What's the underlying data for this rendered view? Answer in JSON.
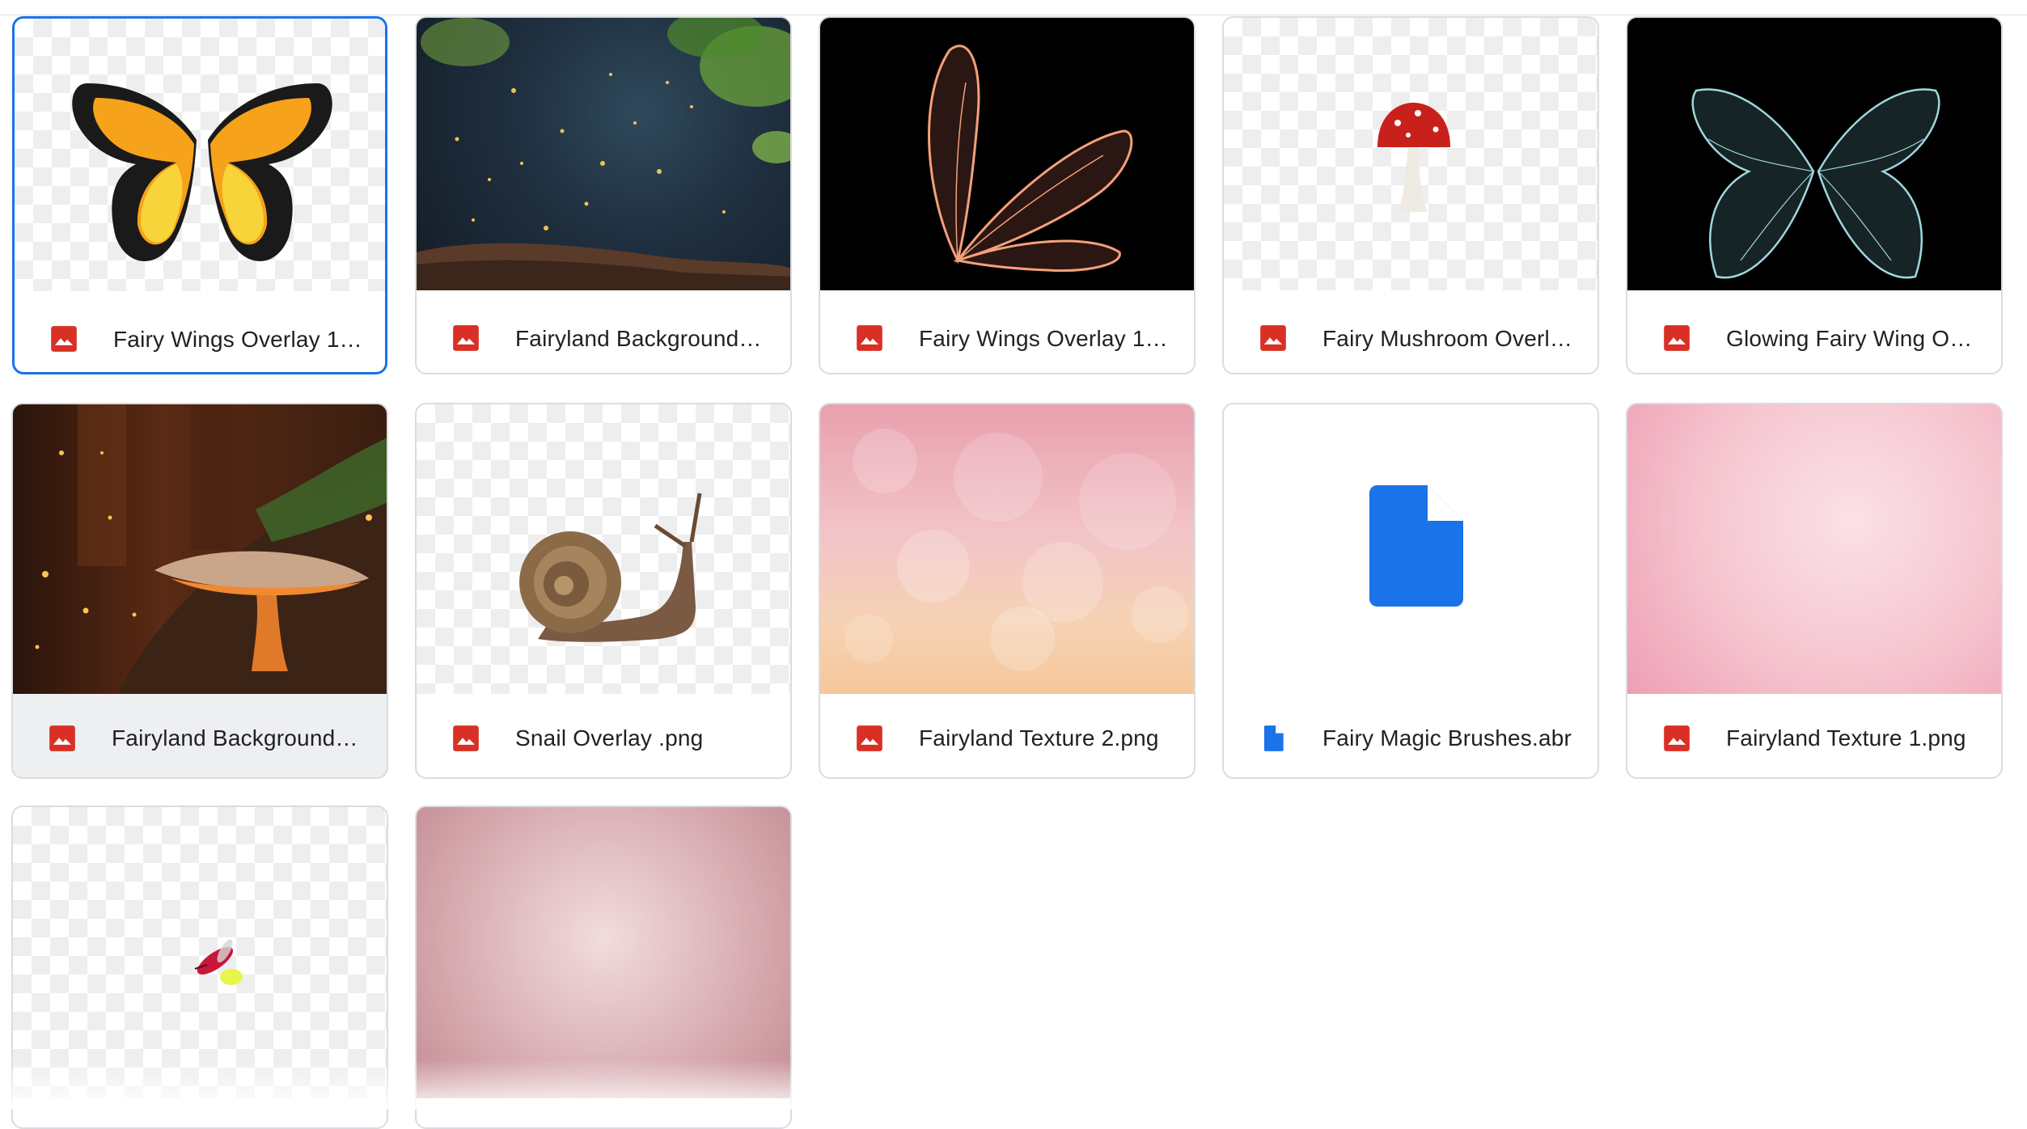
{
  "files": [
    {
      "name": "Fairy Wings Overlay 1 …",
      "type_icon": "image-file-icon",
      "thumbnail": "yellow-butterfly-wings"
    },
    {
      "name": "Fairyland Background …",
      "type_icon": "image-file-icon",
      "thumbnail": "forest-bokeh"
    },
    {
      "name": "Fairy Wings Overlay 1.…",
      "type_icon": "image-file-icon",
      "thumbnail": "glowing-orange-wings"
    },
    {
      "name": "Fairy Mushroom Overl…",
      "type_icon": "image-file-icon",
      "thumbnail": "red-mushroom"
    },
    {
      "name": "Glowing Fairy Wing Ov…",
      "type_icon": "image-file-icon",
      "thumbnail": "blue-fairy-wings"
    },
    {
      "name": "Fairyland Background …",
      "type_icon": "image-file-icon",
      "thumbnail": "mushroom-forest"
    },
    {
      "name": "Snail Overlay .png",
      "type_icon": "image-file-icon",
      "thumbnail": "snail"
    },
    {
      "name": "Fairyland Texture 2.png",
      "type_icon": "image-file-icon",
      "thumbnail": "pink-bokeh-texture"
    },
    {
      "name": "Fairy Magic Brushes.abr",
      "type_icon": "generic-file-icon",
      "thumbnail": "generic-document"
    },
    {
      "name": "Fairyland Texture 1.png",
      "type_icon": "image-file-icon",
      "thumbnail": "pink-texture"
    },
    {
      "name": "",
      "type_icon": "image-file-icon",
      "thumbnail": "firefly"
    },
    {
      "name": "",
      "type_icon": "image-file-icon",
      "thumbnail": "dusty-rose-texture"
    }
  ],
  "colors": {
    "image_icon": "#d93025",
    "doc_icon": "#1a73e8",
    "selected_border": "#1a73e8",
    "card_border": "#dadce0"
  }
}
